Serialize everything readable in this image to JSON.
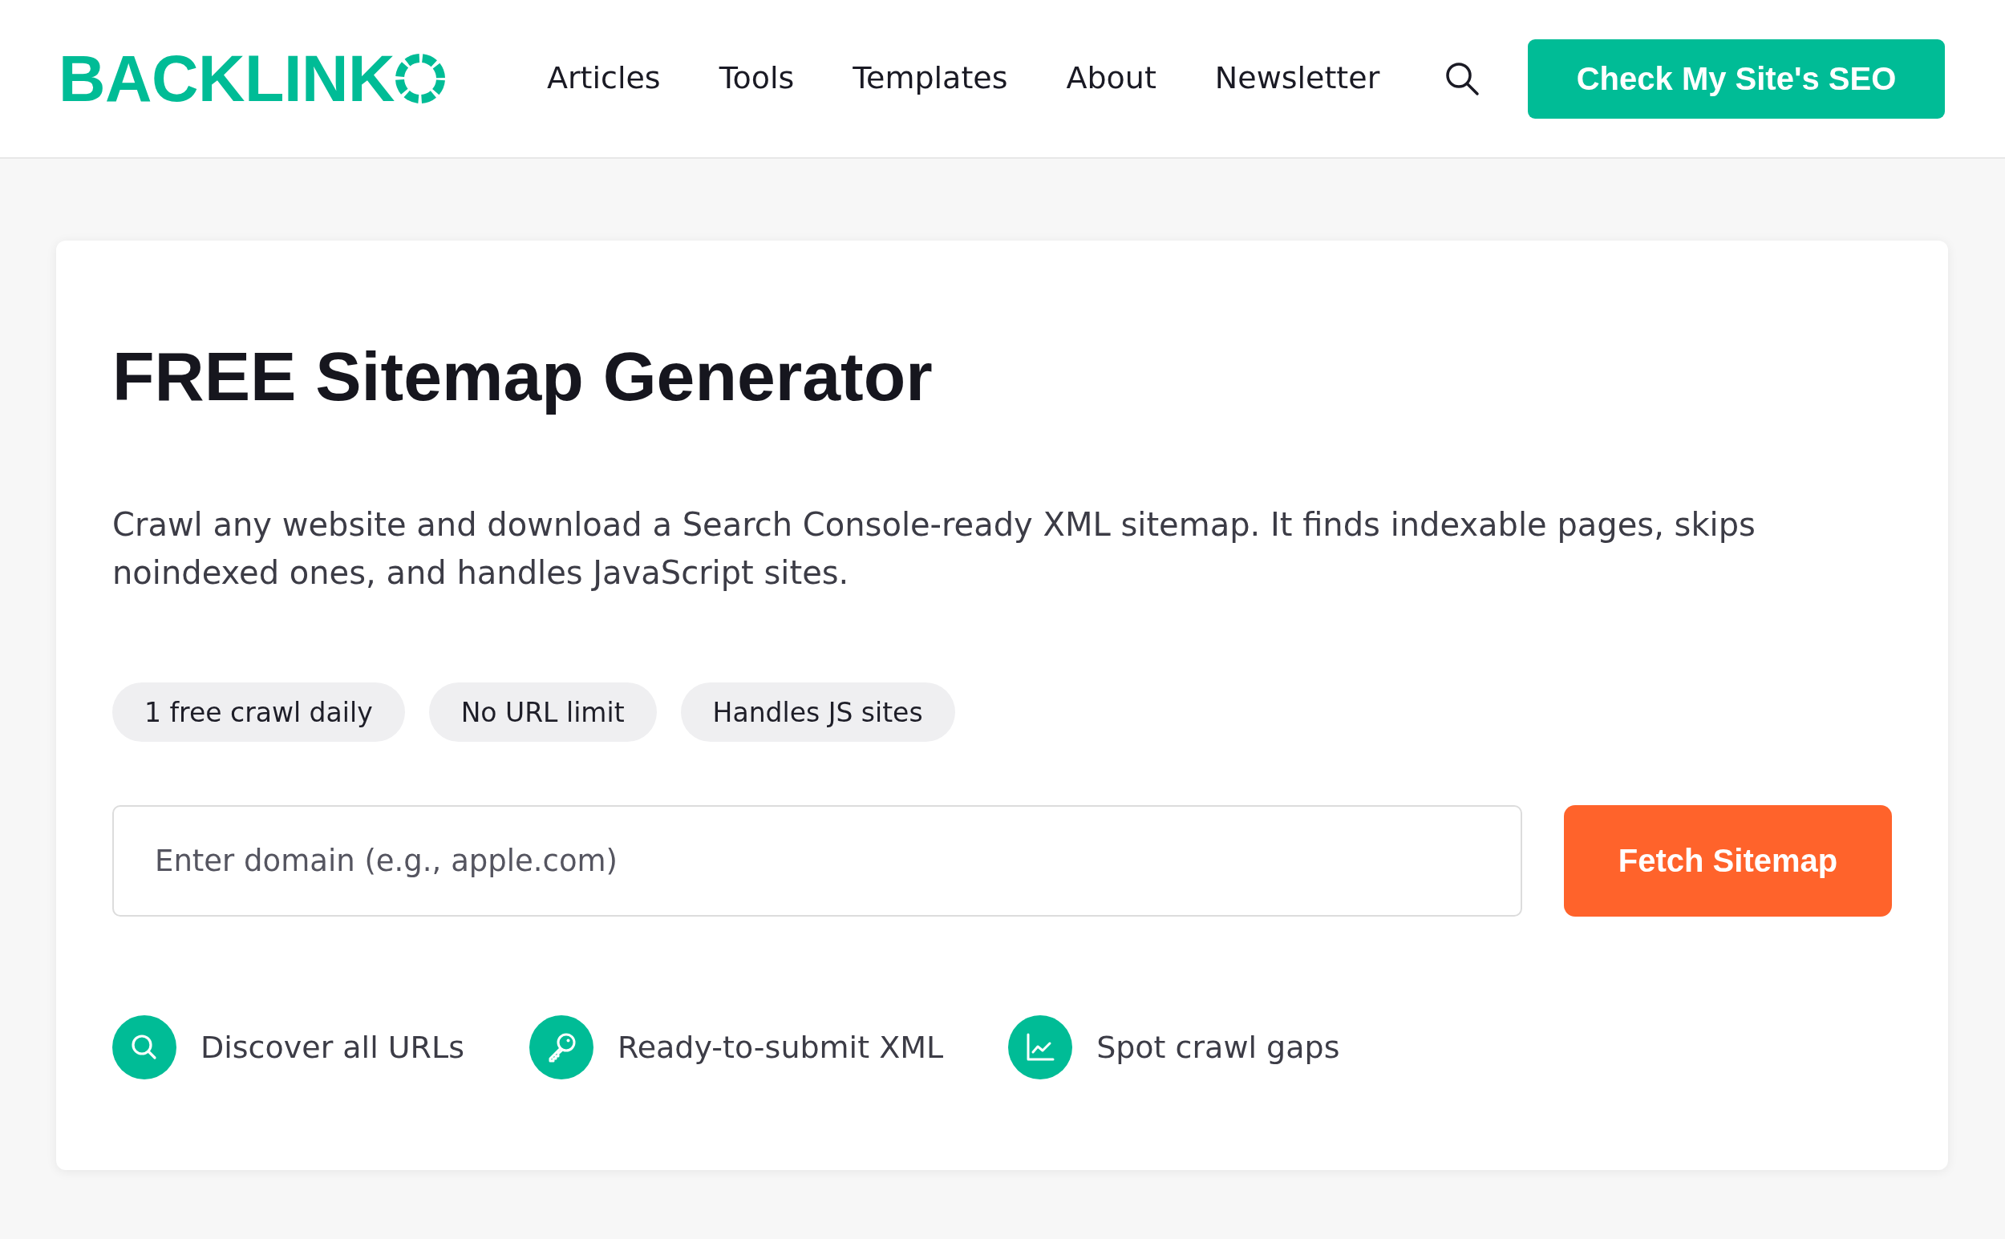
{
  "header": {
    "logo": {
      "wordmark": "BACKLINK"
    },
    "nav": [
      "Articles",
      "Tools",
      "Templates",
      "About",
      "Newsletter"
    ],
    "cta": "Check My Site's SEO"
  },
  "tool": {
    "title": "FREE Sitemap Generator",
    "description": "Crawl any website and download a Search Console-ready XML sitemap. It finds indexable pages, skips noindexed ones, and handles JavaScript sites.",
    "tags": [
      "1 free crawl daily",
      "No URL limit",
      "Handles JS sites"
    ],
    "domain_field": {
      "placeholder": "Enter domain (e.g., apple.com)"
    },
    "submit": "Fetch Sitemap",
    "features": [
      {
        "kind": "search",
        "label": "Discover all URLs"
      },
      {
        "kind": "key",
        "label": "Ready-to-submit XML"
      },
      {
        "kind": "chart",
        "label": "Spot crawl gaps"
      }
    ]
  }
}
